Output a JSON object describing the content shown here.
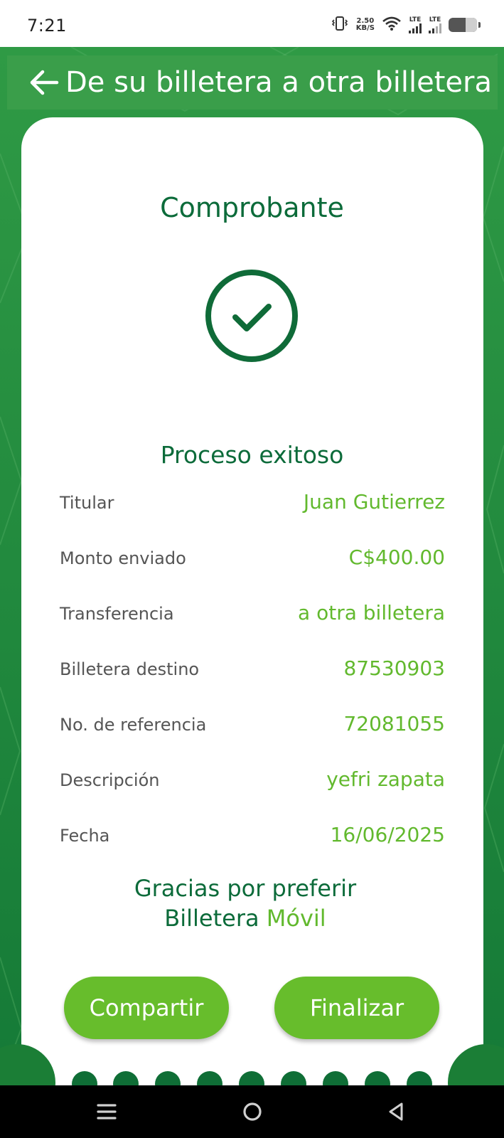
{
  "status_bar": {
    "time": "7:21",
    "net_speed_value": "2.50",
    "net_speed_unit": "KB/S",
    "sim1": "LTE",
    "sim2": "LTE",
    "battery_level": 0.4
  },
  "header": {
    "back_icon": "arrow-left-icon",
    "title": "De su billetera a otra billetera"
  },
  "receipt": {
    "title": "Comprobante",
    "status_icon": "check-circle-icon",
    "status_text": "Proceso exitoso",
    "rows": [
      {
        "label": "Titular",
        "value": "Juan Gutierrez"
      },
      {
        "label": "Monto enviado",
        "value": "C$400.00"
      },
      {
        "label": "Transferencia",
        "value": "a otra billetera"
      },
      {
        "label": "Billetera destino",
        "value": "87530903"
      },
      {
        "label": "No. de referencia",
        "value": "72081055"
      },
      {
        "label": "Descripción",
        "value": "yefri zapata"
      },
      {
        "label": "Fecha",
        "value": "16/06/2025"
      }
    ],
    "thanks_line1": "Gracias por preferir",
    "thanks_line2a": "Billetera",
    "thanks_line2b": "Móvil"
  },
  "buttons": {
    "share": "Compartir",
    "finish": "Finalizar"
  },
  "nav": {
    "menu_icon": "menu-icon",
    "home_icon": "home-circle-icon",
    "back_icon": "triangle-back-icon"
  },
  "colors": {
    "brand_dark": "#0c6b3a",
    "brand_accent": "#62b92e",
    "background": "#1f8a3b",
    "header": "#3a9e4a",
    "button": "#67bd2c"
  }
}
